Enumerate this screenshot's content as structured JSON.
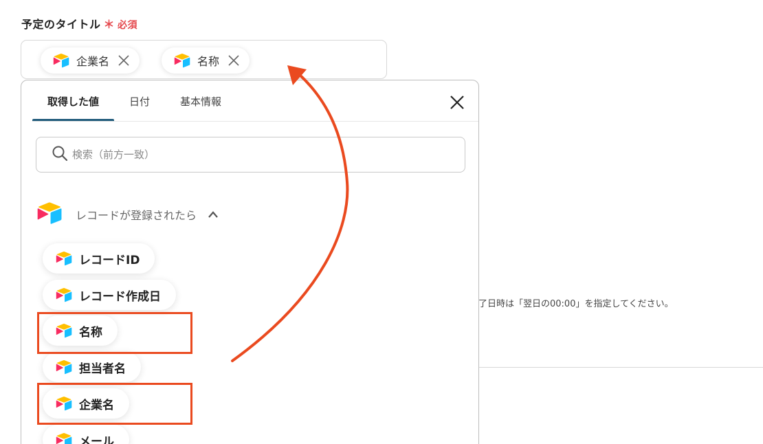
{
  "field": {
    "label": "予定のタイトル",
    "required_mark": "＊",
    "required_text": "必須"
  },
  "tokens": [
    {
      "label": "企業名",
      "icon": "airtable-icon",
      "close_icon": "close-icon"
    },
    {
      "label": "名称",
      "icon": "airtable-icon",
      "close_icon": "close-icon"
    }
  ],
  "picker": {
    "tabs": [
      "取得した値",
      "日付",
      "基本情報"
    ],
    "active_tab": "取得した値",
    "search_placeholder": "検索（前方一致）",
    "group_label": "レコードが登録されたら",
    "items": [
      "レコードID",
      "レコード作成日",
      "名称",
      "担当者名",
      "企業名",
      "メール"
    ],
    "highlighted_items": [
      "名称",
      "企業名"
    ]
  },
  "background": {
    "hint_text": "了日時は「翌日の00:00」を指定してください。"
  },
  "colors": {
    "required": "#e5484d",
    "tab_indicator": "#1f5a7a",
    "annotation": "#ea4a1f"
  }
}
